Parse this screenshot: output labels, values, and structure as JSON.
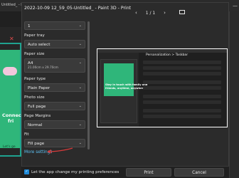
{
  "background": {
    "title": "Untitled_ - P",
    "connect_text": [
      "Connec",
      "fri"
    ],
    "lets_text": "Let's ge"
  },
  "dialog": {
    "title": "2022-10-09 12_59_05-Untitled_ - Paint 3D - Print",
    "page_indicator": "1 / 1",
    "copies": "1",
    "fields": [
      {
        "label": "Paper tray",
        "value": "Auto select"
      },
      {
        "label": "Paper size",
        "value": "A4",
        "sub": "21.00cm x 29.70cm"
      },
      {
        "label": "Paper type",
        "value": "Plain Paper"
      },
      {
        "label": "Photo size",
        "value": "Full page"
      },
      {
        "label": "Page Margins",
        "value": "Normal"
      },
      {
        "label": "Fit",
        "value": "Fill page"
      }
    ],
    "more_settings": "More settings",
    "checkbox_label": "Let the app change my printing preferences",
    "print_button": "Print",
    "cancel_button": "Cancel"
  },
  "preview": {
    "heading": "Personalization  >  Taskbar",
    "green_text": [
      "Stay in touch with family and",
      "friends, anytime, anywhere"
    ]
  },
  "colors": {
    "link": "#5ec1f3",
    "accent_check": "#1f8ad8",
    "annotation_arrow": "#d93a3a"
  },
  "icons": [
    "chevron-down-icon",
    "prev-page-icon",
    "next-page-icon",
    "fit-page-icon",
    "checkbox-checked-icon"
  ]
}
